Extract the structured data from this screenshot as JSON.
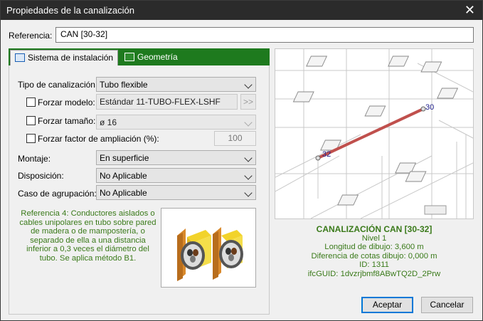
{
  "window": {
    "title": "Propiedades de la canalización",
    "close_glyph": "✕"
  },
  "referencia": {
    "label": "Referencia:",
    "value": "CAN [30-32]"
  },
  "tabs": [
    {
      "label": "Sistema de instalación",
      "icon": "installation-system-icon",
      "active": true
    },
    {
      "label": "Geometría",
      "icon": "geometry-icon",
      "active": false
    }
  ],
  "form": {
    "tipo": {
      "label": "Tipo de canalización:",
      "value": "Tubo flexible"
    },
    "forzar_modelo": {
      "label": "Forzar modelo:",
      "value": "Estándar 11-TUBO-FLEX-LSHF",
      "button": ">>"
    },
    "forzar_tamano": {
      "label": "Forzar tamaño:",
      "value": "ø 16"
    },
    "forzar_factor": {
      "label": "Forzar factor de ampliación (%):",
      "value": "100"
    },
    "montaje": {
      "label": "Montaje:",
      "value": "En superficie"
    },
    "disposicion": {
      "label": "Disposición:",
      "value": "No Aplicable"
    },
    "caso": {
      "label": "Caso de agrupación:",
      "value": "No Aplicable"
    }
  },
  "reference_note": "Referencia 4: Conductores aislados o cables unipolares en tubo sobre pared de madera o de mampostería, o separado de ella a una distancia inferior a 0,3 veces el diámetro del tubo. Se aplica método B1.",
  "preview": {
    "label_start": "30",
    "label_end": "32",
    "accent": "#c0504d"
  },
  "info": {
    "heading": "CANALIZACIÓN CAN [30-32]",
    "nivel": "Nivel 1",
    "longitud": "Longitud de dibujo: 3,600 m",
    "diferencia": "Diferencia de cotas dibujo: 0,000 m",
    "id": "ID: 1311",
    "guid": "ifcGUID: 1dvzrjbmf8ABwTQ2D_2Prw"
  },
  "buttons": {
    "ok": "Aceptar",
    "cancel": "Cancelar"
  },
  "colors": {
    "title_bar": "#2b2b2b",
    "tab_strip": "#1e7a1e",
    "info_text": "#3a7a1a",
    "default_button_border": "#0078d7"
  }
}
